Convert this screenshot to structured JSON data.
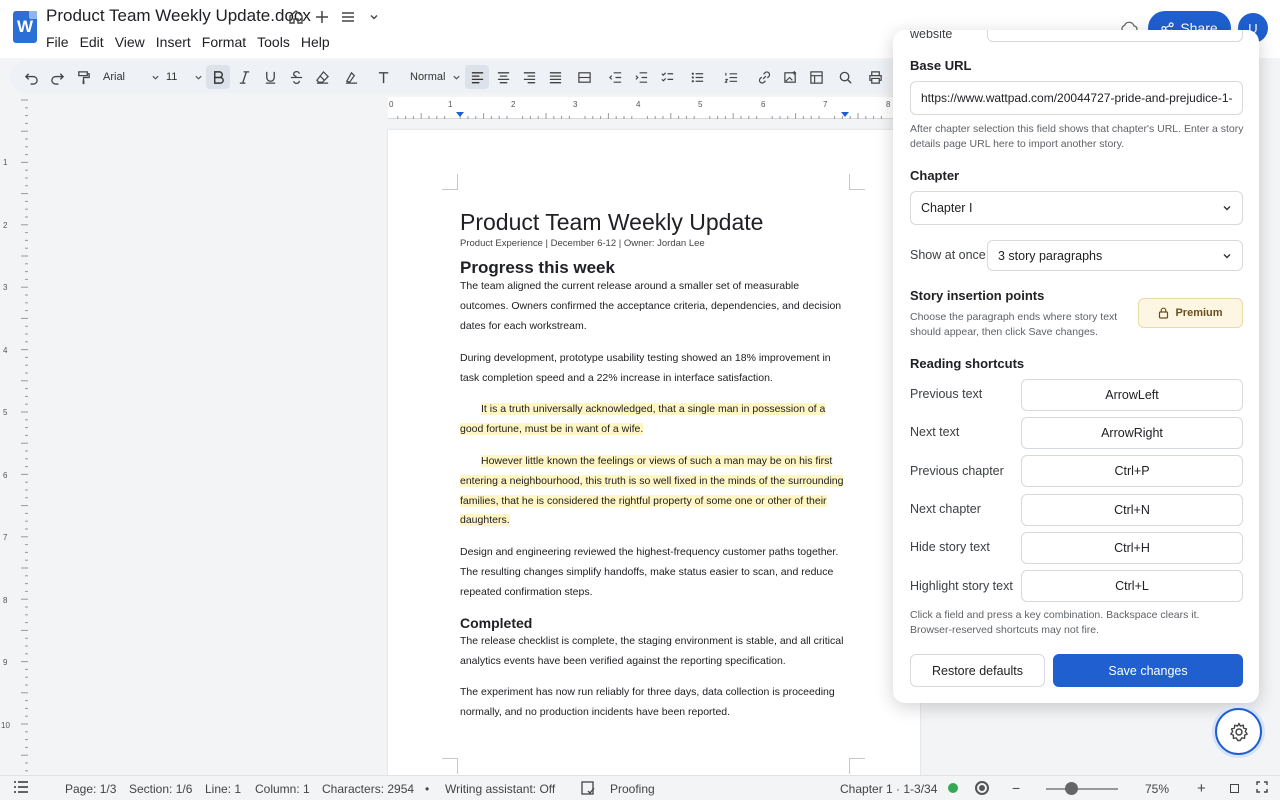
{
  "app": {
    "logo_letter": "W",
    "doc_title": "Product Team Weekly Update.docx",
    "menu": [
      "File",
      "Edit",
      "View",
      "Insert",
      "Format",
      "Tools",
      "Help"
    ],
    "share_label": "Share",
    "avatar_initial": "U",
    "accent_color": "#1f5fcf"
  },
  "toolbar": {
    "font": "Arial",
    "font_size": "11",
    "style": "Normal"
  },
  "ruler": {
    "h_numbers": [
      "0",
      "1",
      "2",
      "3",
      "4",
      "5",
      "6",
      "7",
      "8"
    ],
    "v_numbers": [
      "1",
      "2",
      "3",
      "4",
      "5",
      "6",
      "7",
      "8",
      "9",
      "10"
    ]
  },
  "document": {
    "title": "Product Team Weekly Update",
    "meta": "Product Experience | December 6-12 | Owner: Jordan Lee",
    "heading_progress": "Progress this week",
    "p1_l1": "The team aligned the current release around a smaller set of measurable",
    "p1_l2": "outcomes. Owners confirmed the acceptance criteria, dependencies, and decision",
    "p1_l3": "dates for each workstream.",
    "p2_l1": "During development, prototype usability testing showed an 18% improvement in",
    "p2_l2": "task completion speed and a 22% increase in interface satisfaction.",
    "s1_l1": "It is a truth universally acknowledged, that a single man in possession of a",
    "s1_l2": "good fortune, must be in want of a wife.",
    "s2_l1": "However little known the feelings or views of such a man may be on his first",
    "s2_l2": "entering a neighbourhood, this truth is so well fixed in the minds of the surrounding",
    "s2_l3": "families, that he is considered the rightful property of some one or other of their",
    "s2_l4": "daughters.",
    "p3_l1": "Design and engineering reviewed the highest-frequency customer paths together.",
    "p3_l2": "The resulting changes simplify handoffs, make status easier to scan, and reduce",
    "p3_l3": "repeated confirmation steps.",
    "heading_completed": "Completed",
    "p4_l1": "The release checklist is complete, the staging environment is stable, and all critical",
    "p4_l2": "analytics events have been verified against the reporting specification.",
    "p5_l1": "The experiment has now run reliably for three days, data collection is proceeding",
    "p5_l2": "normally, and no production incidents have been reported."
  },
  "panel": {
    "partial_label": "website",
    "base_url_label": "Base URL",
    "base_url_value": "https://www.wattpad.com/20044727-pride-and-prejudice-1-",
    "base_url_help_l1": "After chapter selection this field shows that chapter's URL. Enter a story",
    "base_url_help_l2": "details page URL here to import another story.",
    "chapter_label": "Chapter",
    "chapter_value": "Chapter I",
    "show_at_once_label": "Show at once",
    "show_at_once_value": "3 story paragraphs",
    "insertion_label": "Story insertion points",
    "insertion_help_l1": "Choose the paragraph ends where story text",
    "insertion_help_l2": "should appear, then click Save changes.",
    "premium_label": "Premium",
    "shortcuts_label": "Reading shortcuts",
    "shortcuts": [
      {
        "label": "Previous text",
        "key": "ArrowLeft"
      },
      {
        "label": "Next text",
        "key": "ArrowRight"
      },
      {
        "label": "Previous chapter",
        "key": "Ctrl+P"
      },
      {
        "label": "Next chapter",
        "key": "Ctrl+N"
      },
      {
        "label": "Hide story text",
        "key": "Ctrl+H"
      },
      {
        "label": "Highlight story text",
        "key": "Ctrl+L"
      }
    ],
    "shortcuts_help_l1": "Click a field and press a key combination. Backspace clears it.",
    "shortcuts_help_l2": "Browser-reserved shortcuts may not fire.",
    "restore_label": "Restore defaults",
    "save_label": "Save changes"
  },
  "status": {
    "page": "Page: 1/3",
    "section": "Section: 1/6",
    "line": "Line: 1",
    "column": "Column: 1",
    "characters": "Characters: 2954",
    "bullet": "•",
    "assistant": "Writing assistant: Off",
    "proofing": "Proofing",
    "chapter_position": "Chapter 1 · 1-3/34",
    "zoom_minus": "−",
    "zoom_value": "75%",
    "zoom_plus": "+",
    "zoom_level": 0.35
  }
}
